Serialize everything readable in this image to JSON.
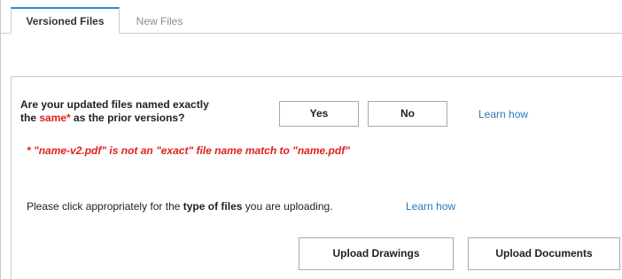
{
  "tabs": {
    "active_label": "Versioned Files",
    "inactive_label": "New Files"
  },
  "versioning": {
    "question_line1": "Are your updated files named exactly",
    "question_line2_before": "the ",
    "question_line2_highlight": "same*",
    "question_line2_after": " as the prior versions?",
    "yes_label": "Yes",
    "no_label": "No",
    "learn_how_label": "Learn how",
    "footnote": "* \"name-v2.pdf\" is not an \"exact\" file name match to \"name.pdf\""
  },
  "upload": {
    "instruction_before": "Please click appropriately for the ",
    "instruction_bold": "type of files",
    "instruction_after": " you are uploading.",
    "learn_how_label": "Learn how",
    "drawings_label": "Upload Drawings",
    "documents_label": "Upload Documents"
  },
  "colors": {
    "accent_tab": "#2a8ad4",
    "link": "#2a7ab8",
    "warning_red": "#e0201a"
  }
}
